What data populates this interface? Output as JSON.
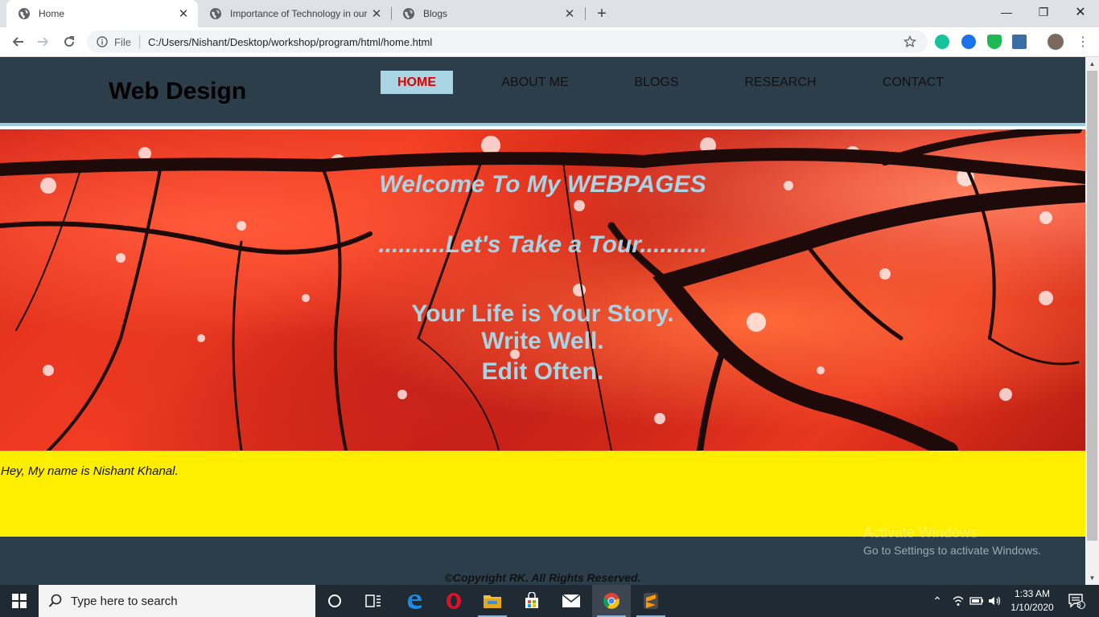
{
  "browser": {
    "tabs": [
      {
        "title": "Home"
      },
      {
        "title": "Importance of Technology in our"
      },
      {
        "title": "Blogs"
      }
    ],
    "address": {
      "scheme_label": "File",
      "url": "C:/Users/Nishant/Desktop/workshop/program/html/home.html"
    }
  },
  "site": {
    "logo": "Web Design",
    "nav": [
      "HOME",
      "ABOUT ME",
      "BLOGS",
      "RESEARCH",
      "CONTACT"
    ],
    "hero": {
      "line1": "Welcome To My WEBPAGES",
      "line2": "..........Let's Take a Tour..........",
      "quote_line1": "Your Life is Your Story.",
      "quote_line2": "Write Well.",
      "quote_line3": "Edit Often."
    },
    "intro": "Hey, My name is Nishant Khanal.",
    "footer": "©Copyright RK. All Rights Reserved."
  },
  "windows": {
    "activate_title": "Activate Windows",
    "activate_sub": "Go to Settings to activate Windows.",
    "search_placeholder": "Type here to search",
    "time": "1:33 AM",
    "date": "1/10/2020",
    "notifications": "3"
  },
  "colors": {
    "header_bg": "#2c3e4a",
    "accent": "#a9d4e4",
    "active_nav_text": "#e00000",
    "intro_bg": "#ffee00"
  }
}
